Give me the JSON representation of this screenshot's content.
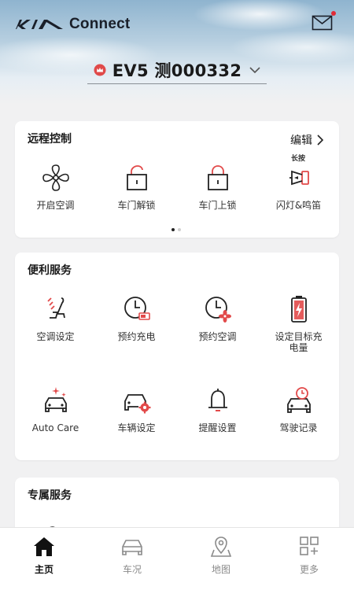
{
  "header": {
    "brand": "Connect",
    "vehicle": "EV5 测000332",
    "mail_has_unread": true
  },
  "remote": {
    "title": "远程控制",
    "edit_label": "编辑",
    "items": [
      {
        "label": "开启空调",
        "icon": "fan-icon"
      },
      {
        "label": "车门解锁",
        "icon": "unlock-icon"
      },
      {
        "label": "车门上锁",
        "icon": "lock-icon"
      },
      {
        "label": "闪灯&鸣笛",
        "icon": "horn-icon",
        "hint": "长按"
      }
    ],
    "pager": {
      "pages": 2,
      "current": 1
    }
  },
  "services": {
    "title": "便利服务",
    "items": [
      {
        "label": "空调设定",
        "icon": "seat-climate-icon"
      },
      {
        "label": "预约充电",
        "icon": "clock-battery-icon"
      },
      {
        "label": "预约空调",
        "icon": "clock-fan-icon"
      },
      {
        "label": "设定目标充电量",
        "icon": "battery-charge-icon"
      },
      {
        "label": "Auto Care",
        "icon": "car-sparkle-icon"
      },
      {
        "label": "车辆设定",
        "icon": "car-gear-icon"
      },
      {
        "label": "提醒设置",
        "icon": "bell-icon"
      },
      {
        "label": "驾驶记录",
        "icon": "car-clock-icon"
      }
    ]
  },
  "exclusive": {
    "title": "专属服务"
  },
  "bottom_nav": [
    {
      "label": "主页",
      "icon": "home-icon",
      "active": true
    },
    {
      "label": "车况",
      "icon": "car-status-icon",
      "active": false
    },
    {
      "label": "地图",
      "icon": "map-pin-icon",
      "active": false
    },
    {
      "label": "更多",
      "icon": "grid-plus-icon",
      "active": false
    }
  ],
  "colors": {
    "accent": "#e24a4a",
    "ink": "#1a1f29",
    "background": "#f1f1f2"
  }
}
